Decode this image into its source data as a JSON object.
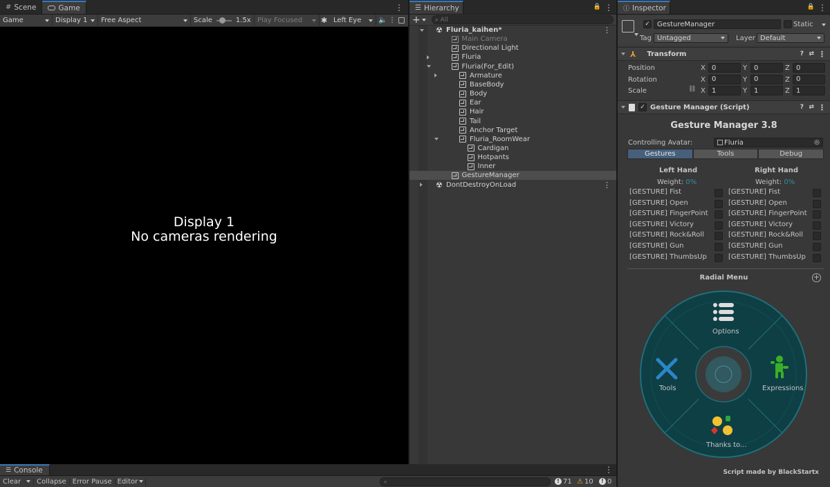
{
  "scene_tabs": {
    "scene": "Scene",
    "game": "Game"
  },
  "game_toolbar": {
    "mode": "Game",
    "display": "Display 1",
    "aspect": "Free Aspect",
    "scale_label": "Scale",
    "scale_value": "1.5x",
    "play_focused": "Play Focused",
    "eye": "Left Eye"
  },
  "game_view": {
    "line1": "Display 1",
    "line2": "No cameras rendering"
  },
  "hierarchy": {
    "tab": "Hierarchy",
    "search_placeholder": "All",
    "add_label": "+",
    "items": [
      {
        "label": "Fluria_kaihen*",
        "indent": 0,
        "arrow": "down",
        "icon": "unity",
        "dim": false,
        "bold": true
      },
      {
        "label": "Main Camera",
        "indent": 1,
        "arrow": "",
        "icon": "cube",
        "dim": true
      },
      {
        "label": "Directional Light",
        "indent": 1,
        "arrow": "",
        "icon": "cube",
        "dim": false
      },
      {
        "label": "Fluria",
        "indent": 1,
        "arrow": "right",
        "icon": "cube",
        "dim": false
      },
      {
        "label": "Fluria(For_Edit)",
        "indent": 1,
        "arrow": "down",
        "icon": "cube",
        "dim": false
      },
      {
        "label": "Armature",
        "indent": 2,
        "arrow": "right",
        "icon": "cube",
        "dim": false
      },
      {
        "label": "BaseBody",
        "indent": 2,
        "arrow": "",
        "icon": "cube",
        "dim": false
      },
      {
        "label": "Body",
        "indent": 2,
        "arrow": "",
        "icon": "cube",
        "dim": false
      },
      {
        "label": "Ear",
        "indent": 2,
        "arrow": "",
        "icon": "cube",
        "dim": false
      },
      {
        "label": "Hair",
        "indent": 2,
        "arrow": "",
        "icon": "cube",
        "dim": false
      },
      {
        "label": "Tail",
        "indent": 2,
        "arrow": "",
        "icon": "cube",
        "dim": false
      },
      {
        "label": "Anchor Target",
        "indent": 2,
        "arrow": "",
        "icon": "cube",
        "dim": false
      },
      {
        "label": "Fluria_RoomWear",
        "indent": 2,
        "arrow": "down",
        "icon": "cube",
        "dim": false
      },
      {
        "label": "Cardigan",
        "indent": 3,
        "arrow": "",
        "icon": "cube",
        "dim": false
      },
      {
        "label": "Hotpants",
        "indent": 3,
        "arrow": "",
        "icon": "cube",
        "dim": false
      },
      {
        "label": "Inner",
        "indent": 3,
        "arrow": "",
        "icon": "cube",
        "dim": false
      },
      {
        "label": "GestureManager",
        "indent": 1,
        "arrow": "",
        "icon": "cube",
        "dim": false,
        "selected": true
      },
      {
        "label": "DontDestroyOnLoad",
        "indent": 0,
        "arrow": "right",
        "icon": "unity",
        "dim": false
      }
    ]
  },
  "inspector": {
    "tab": "Inspector",
    "object_name": "GestureManager",
    "static_label": "Static",
    "tag_label": "Tag",
    "tag_value": "Untagged",
    "layer_label": "Layer",
    "layer_value": "Default",
    "transform": {
      "title": "Transform",
      "rows": [
        {
          "label": "Position",
          "x": "0",
          "y": "0",
          "z": "0"
        },
        {
          "label": "Rotation",
          "x": "0",
          "y": "0",
          "z": "0"
        },
        {
          "label": "Scale",
          "x": "1",
          "y": "1",
          "z": "1"
        }
      ],
      "x": "X",
      "y": "Y",
      "z": "Z"
    },
    "script": {
      "title": "Gesture Manager (Script)",
      "header": "Gesture Manager 3.8",
      "avatar_label": "Controlling Avatar:",
      "avatar_value": "Fluria",
      "tabs": [
        "Gestures",
        "Tools",
        "Debug"
      ],
      "left_hand": "Left Hand",
      "right_hand": "Right Hand",
      "weight_label": "Weight:",
      "weight_value": "0%",
      "gestures": [
        "[GESTURE] Fist",
        "[GESTURE] Open",
        "[GESTURE] FingerPoint",
        "[GESTURE] Victory",
        "[GESTURE] Rock&Roll",
        "[GESTURE] Gun",
        "[GESTURE] ThumbsUp"
      ],
      "radial_title": "Radial Menu",
      "radial_items": {
        "top": "Options",
        "left": "Tools",
        "right": "Expressions",
        "bottom": "Thanks to..."
      },
      "credit": "Script made by BlackStartx"
    }
  },
  "console": {
    "tab": "Console",
    "clear": "Clear",
    "collapse": "Collapse",
    "error_pause": "Error Pause",
    "editor": "Editor",
    "count_log": "71",
    "count_warn": "10",
    "count_error": "0"
  },
  "colors": {
    "accent": "#3a79bb",
    "teal": "#2e8fa0",
    "selected_row": "#2c5d87"
  }
}
